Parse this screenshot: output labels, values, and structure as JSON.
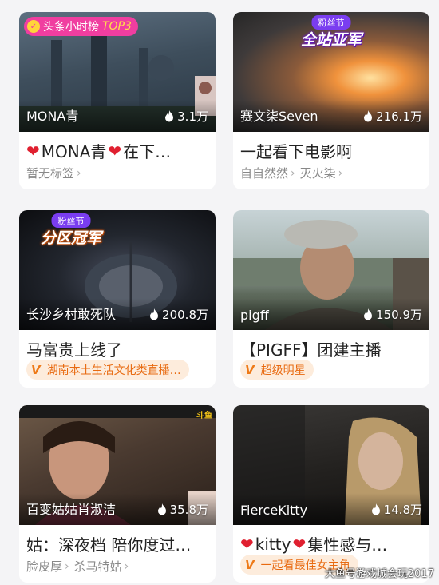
{
  "cards": [
    {
      "streamer": "MONA青",
      "hot": "3.1万",
      "title": "MONA青",
      "title_tail": "在下…",
      "tags": [
        "暂无标签"
      ],
      "rank_badge": {
        "label": "头条小时榜",
        "top": "TOP3"
      }
    },
    {
      "streamer": "赛文柒Seven",
      "hot": "216.1万",
      "title": "一起看下电影啊",
      "tags": [
        "自自然然",
        "灭火柒"
      ],
      "fest": {
        "line1": "粉丝节",
        "line2": "全站亚军"
      }
    },
    {
      "streamer": "长沙乡村敢死队",
      "hot": "200.8万",
      "title": "马富贵上线了",
      "badge": {
        "v": "V",
        "label": "湖南本土生活文化类直播…"
      },
      "fest": {
        "line1": "粉丝节",
        "line2": "分区冠军"
      }
    },
    {
      "streamer": "pigff",
      "hot": "150.9万",
      "title": "【PIGFF】团建主播",
      "badge": {
        "v": "V",
        "label": "超级明星"
      }
    },
    {
      "streamer": "百变姑姑肖淑洁",
      "hot": "35.8万",
      "title": "姑：深夜档 陪你度过…",
      "tags": [
        "脸皮厚",
        "杀马特姑"
      ],
      "corner_tag": "斗鱼"
    },
    {
      "streamer": "FierceKitty",
      "hot": "14.8万",
      "title": "kitty",
      "title_tail": "集性感与…",
      "badge": {
        "v": "V",
        "label": "一起看最佳女主角"
      }
    }
  ],
  "watermark": "大鱼号游戏城会玩2017"
}
